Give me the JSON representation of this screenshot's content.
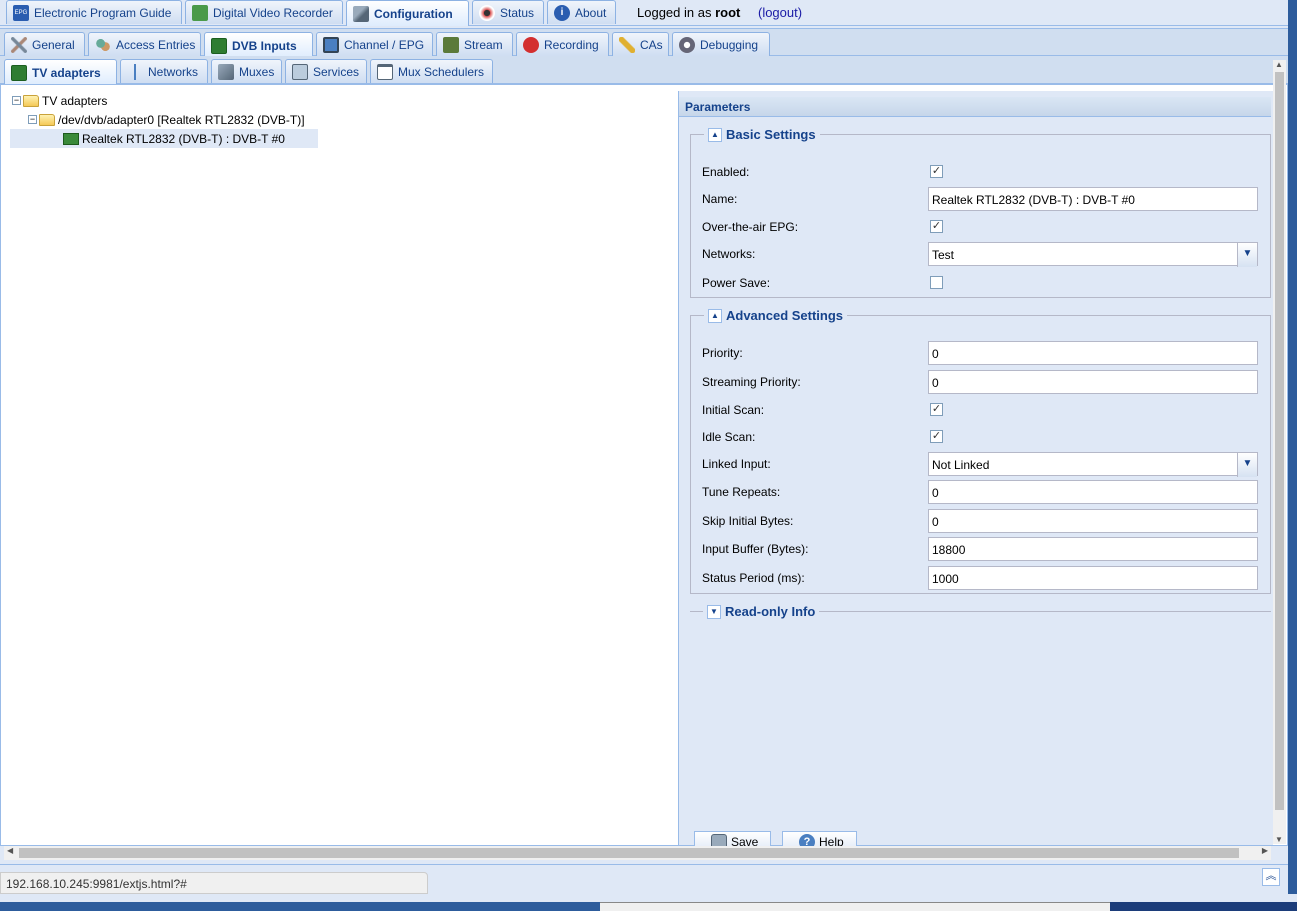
{
  "main_tabs": [
    {
      "label": "Electronic Program Guide",
      "icon": "epg-icon"
    },
    {
      "label": "Digital Video Recorder",
      "icon": "download-icon"
    },
    {
      "label": "Configuration",
      "icon": "wrench-icon",
      "active": true
    },
    {
      "label": "Status",
      "icon": "eye-icon"
    },
    {
      "label": "About",
      "icon": "info-icon"
    }
  ],
  "login": {
    "prefix": "Logged in as",
    "user": "root",
    "logout": "(logout)"
  },
  "config_tabs": [
    {
      "label": "General",
      "icon": "tools-icon"
    },
    {
      "label": "Access Entries",
      "icon": "users-icon"
    },
    {
      "label": "DVB Inputs",
      "icon": "tuner-card-icon",
      "active": true
    },
    {
      "label": "Channel / EPG",
      "icon": "tv-icon"
    },
    {
      "label": "Stream",
      "icon": "stream-icon"
    },
    {
      "label": "Recording",
      "icon": "rec-icon"
    },
    {
      "label": "CAs",
      "icon": "key-icon"
    },
    {
      "label": "Debugging",
      "icon": "gears-icon"
    }
  ],
  "dvb_tabs": [
    {
      "label": "TV adapters",
      "icon": "tuner-card-icon",
      "active": true
    },
    {
      "label": "Networks",
      "icon": "antenna-icon"
    },
    {
      "label": "Muxes",
      "icon": "satellite-icon"
    },
    {
      "label": "Services",
      "icon": "services-icon"
    },
    {
      "label": "Mux Schedulers",
      "icon": "calendar-check-icon"
    }
  ],
  "tree": {
    "root": "TV adapters",
    "adapter": "/dev/dvb/adapter0 [Realtek RTL2832 (DVB-T)]",
    "frontend": "Realtek RTL2832 (DVB-T) : DVB-T #0"
  },
  "params": {
    "title": "Parameters",
    "basic": {
      "legend": "Basic Settings",
      "enabled_label": "Enabled:",
      "enabled": true,
      "name_label": "Name:",
      "name": "Realtek RTL2832 (DVB-T) : DVB-T #0",
      "epg_label": "Over-the-air EPG:",
      "epg": true,
      "networks_label": "Networks:",
      "networks": "Test",
      "powersave_label": "Power Save:",
      "powersave": false
    },
    "advanced": {
      "legend": "Advanced Settings",
      "priority_label": "Priority:",
      "priority": "0",
      "streaming_label": "Streaming Priority:",
      "streaming": "0",
      "initscan_label": "Initial Scan:",
      "initscan": true,
      "idlescan_label": "Idle Scan:",
      "idlescan": true,
      "linked_label": "Linked Input:",
      "linked": "Not Linked",
      "tune_label": "Tune Repeats:",
      "tune": "0",
      "skip_label": "Skip Initial Bytes:",
      "skip": "0",
      "buffer_label": "Input Buffer (Bytes):",
      "buffer": "18800",
      "status_label": "Status Period (ms):",
      "status": "1000"
    },
    "readonly": {
      "legend": "Read-only Info"
    },
    "save_label": "Save",
    "help_label": "Help"
  },
  "status_url": "192.168.10.245:9981/extjs.html?#",
  "check_glyph": "✓"
}
